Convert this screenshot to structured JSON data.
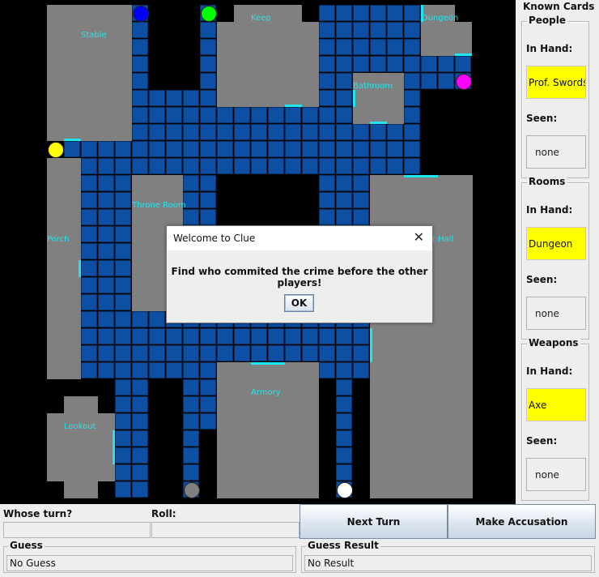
{
  "board": {
    "rooms": [
      {
        "key": "stable",
        "label": "Stable"
      },
      {
        "key": "keep",
        "label": "Keep"
      },
      {
        "key": "dungeon",
        "label": "Dungeon"
      },
      {
        "key": "bathroom",
        "label": "Bathroom"
      },
      {
        "key": "throne",
        "label": "Throne Room"
      },
      {
        "key": "porch",
        "label": "Porch"
      },
      {
        "key": "great-hall",
        "label": "Great Hall"
      },
      {
        "key": "armory",
        "label": "Armory"
      },
      {
        "key": "lookout",
        "label": "Lookout"
      }
    ],
    "players": [
      {
        "key": "blue",
        "color": "#0000ff"
      },
      {
        "key": "green",
        "color": "#00ff00"
      },
      {
        "key": "magenta",
        "color": "#ff00ff"
      },
      {
        "key": "yellow",
        "color": "#ffff00"
      },
      {
        "key": "gray",
        "color": "#808080"
      },
      {
        "key": "white",
        "color": "#ffffff"
      }
    ],
    "colors": {
      "walkway": "#0d4fa3",
      "room": "#808080",
      "door": "#1fe5ef",
      "background": "#000000"
    }
  },
  "known_cards": {
    "title": "Known Cards",
    "people": {
      "title": "People",
      "in_hand_label": "In Hand:",
      "in_hand": "Prof. Swords",
      "seen_label": "Seen:",
      "seen": "none"
    },
    "rooms": {
      "title": "Rooms",
      "in_hand_label": "In Hand:",
      "in_hand": "Dungeon",
      "seen_label": "Seen:",
      "seen": "none"
    },
    "weapons": {
      "title": "Weapons",
      "in_hand_label": "In Hand:",
      "in_hand": "Axe",
      "seen_label": "Seen:",
      "seen": "none"
    }
  },
  "controls": {
    "whose_turn_label": "Whose turn?",
    "whose_turn_value": "",
    "roll_label": "Roll:",
    "roll_value": "",
    "next_turn": "Next Turn",
    "make_accusation": "Make Accusation",
    "guess_title": "Guess",
    "guess_value": "No Guess",
    "guess_result_title": "Guess Result",
    "guess_result_value": "No Result"
  },
  "dialog": {
    "title": "Welcome to Clue",
    "message": "Find who commited the crime before the other players!",
    "ok": "OK",
    "close_glyph": "✕"
  }
}
